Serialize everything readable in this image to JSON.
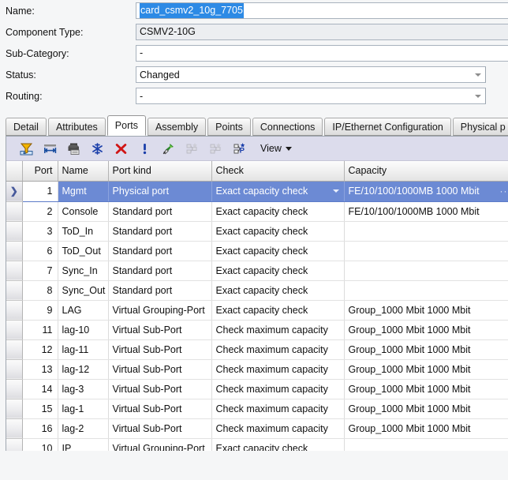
{
  "form": {
    "rows": [
      {
        "label": "Name:",
        "value": "card_csmv2_10g_7705",
        "kind": "text-selected"
      },
      {
        "label": "Component Type:",
        "value": "CSMV2-10G",
        "kind": "readonly"
      },
      {
        "label": "Sub-Category:",
        "value": "-",
        "kind": "text"
      },
      {
        "label": "Status:",
        "value": "Changed",
        "kind": "combo"
      },
      {
        "label": "Routing:",
        "value": "-",
        "kind": "combo"
      }
    ]
  },
  "tabs": {
    "active": "Ports",
    "items": [
      {
        "label": "Detail"
      },
      {
        "label": "Attributes"
      },
      {
        "label": "Ports"
      },
      {
        "label": "Assembly"
      },
      {
        "label": "Points"
      },
      {
        "label": "Connections"
      },
      {
        "label": "IP/Ethernet Configuration"
      },
      {
        "label": "Physical p"
      }
    ]
  },
  "toolbar": {
    "buttons": [
      {
        "name": "filter-icon",
        "disabled": false
      },
      {
        "name": "fit-columns-icon",
        "disabled": false
      },
      {
        "name": "print-icon",
        "disabled": false
      },
      {
        "name": "snowflake-icon",
        "disabled": false
      },
      {
        "name": "delete-icon",
        "disabled": false
      },
      {
        "name": "exclamation-icon",
        "disabled": false
      },
      {
        "name": "pin-icon",
        "disabled": false
      },
      {
        "name": "group-add-icon",
        "disabled": true
      },
      {
        "name": "group-remove-icon",
        "disabled": true
      },
      {
        "name": "group-properties-icon",
        "disabled": false
      }
    ],
    "view_label": "View"
  },
  "table": {
    "columns": [
      {
        "key": "gutter",
        "label": ""
      },
      {
        "key": "port",
        "label": "Port"
      },
      {
        "key": "name",
        "label": "Name"
      },
      {
        "key": "portkind",
        "label": "Port kind"
      },
      {
        "key": "check",
        "label": "Check"
      },
      {
        "key": "capacity",
        "label": "Capacity"
      }
    ],
    "rows": [
      {
        "port": "1",
        "name": "Mgmt",
        "portkind": "Physical port",
        "check": "Exact capacity check",
        "capacity": "FE/10/100/1000MB 1000 Mbit",
        "selected": true,
        "truncated": true
      },
      {
        "port": "2",
        "name": "Console",
        "portkind": "Standard port",
        "check": "Exact capacity check",
        "capacity": "FE/10/100/1000MB 1000 Mbit",
        "selected": false,
        "truncated": false
      },
      {
        "port": "3",
        "name": "ToD_In",
        "portkind": "Standard port",
        "check": "Exact capacity check",
        "capacity": "",
        "selected": false,
        "truncated": false
      },
      {
        "port": "6",
        "name": "ToD_Out",
        "portkind": "Standard port",
        "check": "Exact capacity check",
        "capacity": "",
        "selected": false,
        "truncated": false
      },
      {
        "port": "7",
        "name": "Sync_In",
        "portkind": "Standard port",
        "check": "Exact capacity check",
        "capacity": "",
        "selected": false,
        "truncated": false
      },
      {
        "port": "8",
        "name": "Sync_Out",
        "portkind": "Standard port",
        "check": "Exact capacity check",
        "capacity": "",
        "selected": false,
        "truncated": false
      },
      {
        "port": "9",
        "name": "LAG",
        "portkind": "Virtual Grouping-Port",
        "check": "Exact capacity check",
        "capacity": "Group_1000 Mbit 1000 Mbit",
        "selected": false,
        "truncated": false
      },
      {
        "port": "11",
        "name": "lag-10",
        "portkind": "Virtual Sub-Port",
        "check": "Check maximum capacity",
        "capacity": "Group_1000 Mbit 1000 Mbit",
        "selected": false,
        "truncated": false
      },
      {
        "port": "12",
        "name": "lag-11",
        "portkind": "Virtual Sub-Port",
        "check": "Check maximum capacity",
        "capacity": "Group_1000 Mbit 1000 Mbit",
        "selected": false,
        "truncated": false
      },
      {
        "port": "13",
        "name": "lag-12",
        "portkind": "Virtual Sub-Port",
        "check": "Check maximum capacity",
        "capacity": "Group_1000 Mbit 1000 Mbit",
        "selected": false,
        "truncated": false
      },
      {
        "port": "14",
        "name": "lag-3",
        "portkind": "Virtual Sub-Port",
        "check": "Check maximum capacity",
        "capacity": "Group_1000 Mbit 1000 Mbit",
        "selected": false,
        "truncated": false
      },
      {
        "port": "15",
        "name": "lag-1",
        "portkind": "Virtual Sub-Port",
        "check": "Check maximum capacity",
        "capacity": "Group_1000 Mbit 1000 Mbit",
        "selected": false,
        "truncated": false
      },
      {
        "port": "16",
        "name": "lag-2",
        "portkind": "Virtual Sub-Port",
        "check": "Check maximum capacity",
        "capacity": "Group_1000 Mbit 1000 Mbit",
        "selected": false,
        "truncated": false
      },
      {
        "port": "10",
        "name": "IP",
        "portkind": "Virtual Grouping-Port",
        "check": "Exact capacity check",
        "capacity": "",
        "selected": false,
        "truncated": false
      }
    ]
  },
  "colors": {
    "selection_blue": "#6c8ad4",
    "text_select_blue": "#2d8ae5",
    "toolbar_bg": "#dcdcec",
    "page_bg": "#f5f6f7"
  }
}
